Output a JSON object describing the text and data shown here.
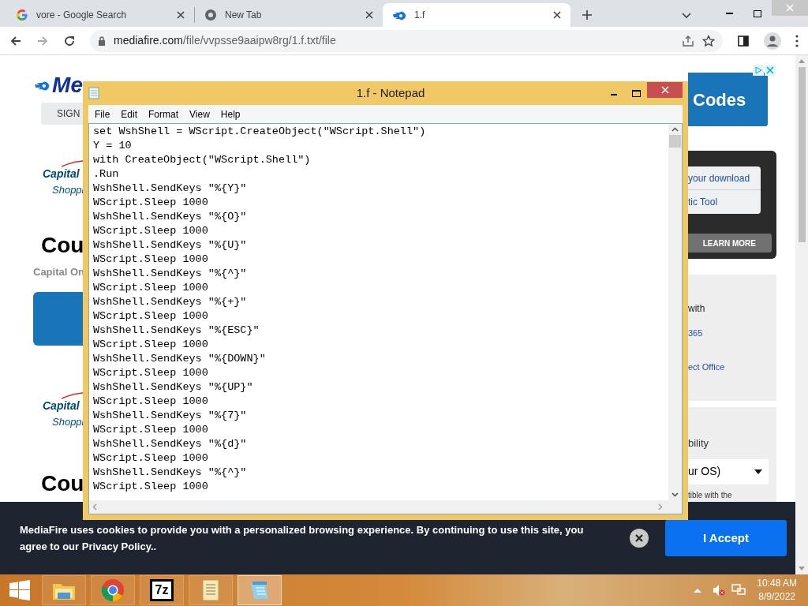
{
  "browser": {
    "tabs": [
      {
        "kind": "google",
        "title": "vore - Google Search",
        "selected": false
      },
      {
        "kind": "chrome",
        "title": "New Tab",
        "selected": false
      },
      {
        "kind": "mediafire",
        "title": "1.f",
        "selected": true
      }
    ],
    "url_host": "mediafire.com",
    "url_path": "/file/vvpsse9aaipw8rg/1.f.txt/file"
  },
  "page": {
    "logo_text": "Me",
    "sign_button": "SIGN",
    "left_blocks": [
      {
        "kind": "full",
        "brand": "Capital",
        "sub": "Shoppi",
        "heading": "Cou",
        "caption": "Capital On"
      },
      {
        "kind": "short",
        "brand": "Capital",
        "sub": "Shoppi",
        "heading": "Cou"
      }
    ],
    "ad_text": "Codes",
    "download_links": [
      "your download",
      "tic Tool"
    ],
    "learn_more": "LEARN MORE",
    "office_panel": {
      "text": "with",
      "links": [
        "365",
        "ect Office"
      ]
    },
    "os_panel": {
      "text": "bility",
      "select": "ur OS)",
      "note": "tible with the"
    }
  },
  "notepad": {
    "title": "1.f - Notepad",
    "menu": [
      "File",
      "Edit",
      "Format",
      "View",
      "Help"
    ],
    "lines": [
      "set WshShell = WScript.CreateObject(\"WScript.Shell\")",
      "Y = 10",
      "with CreateObject(\"WScript.Shell\")",
      ".Run",
      "WshShell.SendKeys \"%{Y}\"",
      "WScript.Sleep 1000",
      "WshShell.SendKeys \"%{O}\"",
      "WScript.Sleep 1000",
      "WshShell.SendKeys \"%{U}\"",
      "WScript.Sleep 1000",
      "WshShell.SendKeys \"%{^}\"",
      "WScript.Sleep 1000",
      "WshShell.SendKeys \"%{+}\"",
      "WScript.Sleep 1000",
      "WshShell.SendKeys \"%{ESC}\"",
      "WScript.Sleep 1000",
      "WshShell.SendKeys \"%{DOWN}\"",
      "WScript.Sleep 1000",
      "WshShell.SendKeys \"%{UP}\"",
      "WScript.Sleep 1000",
      "WshShell.SendKeys \"%{7}\"",
      "WScript.Sleep 1000",
      "WshShell.SendKeys \"%{d}\"",
      "WScript.Sleep 1000",
      "WshShell.SendKeys \"%{^}\"",
      "WScript.Sleep 1000"
    ]
  },
  "cookie_bar": {
    "message": "MediaFire uses cookies to provide you with a personalized browsing experience. By continuing to use this site, you agree to our Privacy Policy..",
    "accept": "I Accept"
  },
  "taskbar": {
    "apps": [
      {
        "kind": "explorer",
        "selected": false
      },
      {
        "kind": "chrome",
        "selected": false
      },
      {
        "kind": "archiver",
        "label": "7z",
        "selected": false
      },
      {
        "kind": "scroll",
        "selected": false
      },
      {
        "kind": "notepad",
        "selected": true
      }
    ],
    "time": "10:48 AM",
    "date": "8/9/2022"
  }
}
